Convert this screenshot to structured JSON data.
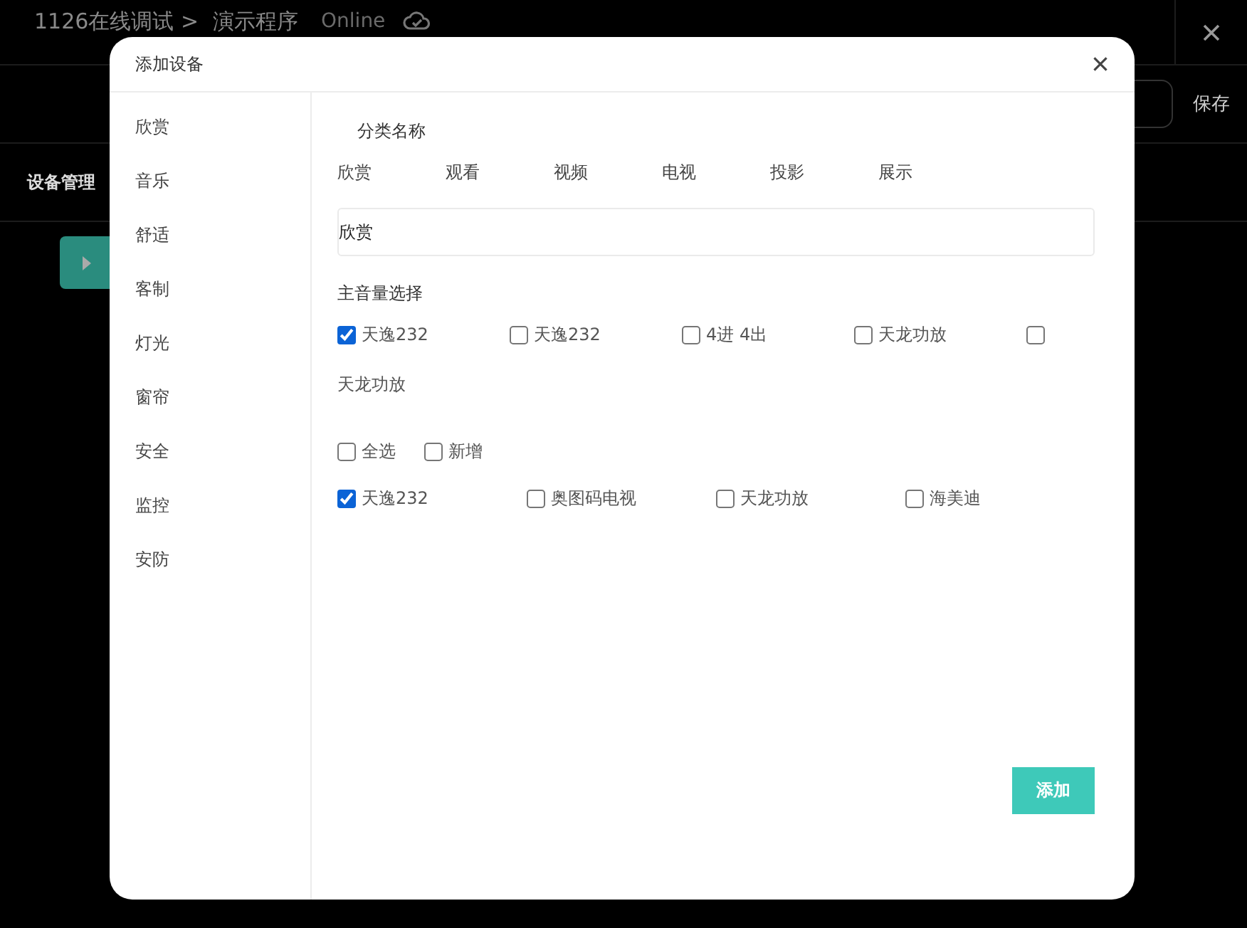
{
  "app": {
    "breadcrumb": "1126在线调试 >",
    "program": "演示程序",
    "status": "Online",
    "save": "保存",
    "tab": "设备管理"
  },
  "dialog": {
    "title": "添加设备",
    "categories": [
      "欣赏",
      "音乐",
      "舒适",
      "客制",
      "灯光",
      "窗帘",
      "安全",
      "监控",
      "安防"
    ],
    "category_heading": "分类名称",
    "category_options": [
      "欣赏",
      "观看",
      "视频",
      "电视",
      "投影",
      "展示"
    ],
    "name_field": {
      "value": "欣赏"
    },
    "volume_heading": "主音量选择",
    "volume_options": [
      {
        "label": "天逸232",
        "checked": true
      },
      {
        "label": "天逸232",
        "checked": false
      },
      {
        "label": "4进 4出",
        "checked": false
      },
      {
        "label": "天龙功放",
        "checked": false
      },
      {
        "label": "天龙功放",
        "checked": false
      }
    ],
    "select_all": {
      "label": "全选",
      "checked": false
    },
    "add_new": {
      "label": "新增",
      "checked": false
    },
    "devices": [
      {
        "label": "天逸232",
        "checked": true
      },
      {
        "label": "奥图码电视",
        "checked": false
      },
      {
        "label": "天龙功放",
        "checked": false
      },
      {
        "label": "海美迪",
        "checked": false
      }
    ],
    "add_button": "添加"
  }
}
